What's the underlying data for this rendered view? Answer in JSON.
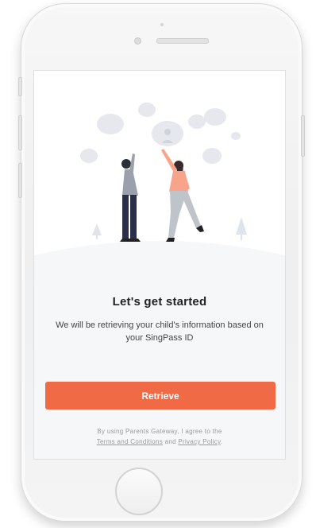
{
  "colors": {
    "accent": "#f06a46",
    "screen_background": "#f6f7f9",
    "title_text": "#222222",
    "body_text": "#444444",
    "muted_text": "#9a9a9a"
  },
  "onboarding": {
    "illustration": "two-people-reaching-for-bubbles-illustration",
    "title": "Let's get started",
    "subtitle": "We will be retrieving your child's information based on your SingPass ID",
    "retrieve_label": "Retrieve",
    "terms": {
      "prefix": "By using Parents Gateway, I agree to the",
      "terms_link": "Terms and Conditions",
      "and": "and",
      "privacy_link": "Privacy Policy",
      "suffix": "."
    }
  },
  "device": {
    "home_button": "home-button"
  }
}
